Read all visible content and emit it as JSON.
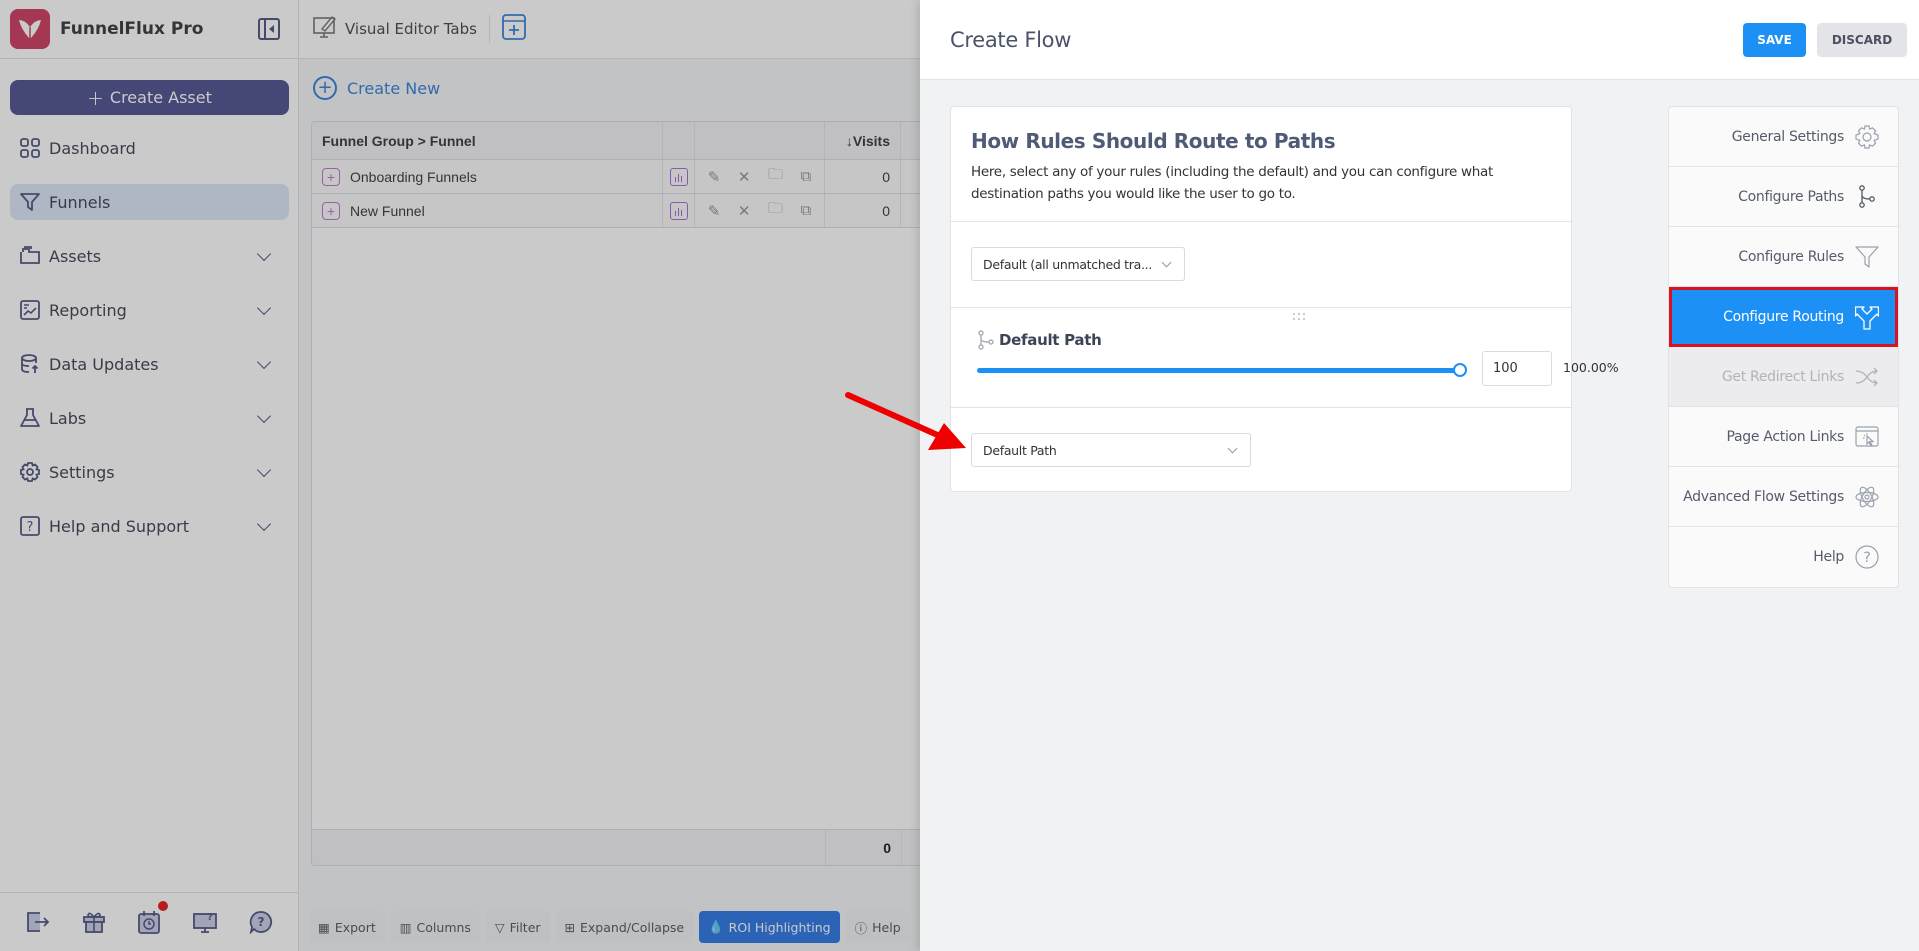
{
  "app": {
    "name": "FunnelFlux Pro",
    "brand_color": "#c8284e"
  },
  "sidebar": {
    "create_asset_label": "Create Asset",
    "items": [
      {
        "label": "Dashboard",
        "icon": "dashboard-icon",
        "active": false,
        "expandable": false
      },
      {
        "label": "Funnels",
        "icon": "funnel-icon",
        "active": true,
        "expandable": false
      },
      {
        "label": "Assets",
        "icon": "folder-icon",
        "active": false,
        "expandable": true
      },
      {
        "label": "Reporting",
        "icon": "report-chart-icon",
        "active": false,
        "expandable": true
      },
      {
        "label": "Data Updates",
        "icon": "database-upload-icon",
        "active": false,
        "expandable": true
      },
      {
        "label": "Labs",
        "icon": "flask-icon",
        "active": false,
        "expandable": true
      },
      {
        "label": "Settings",
        "icon": "gear-icon",
        "active": false,
        "expandable": true
      },
      {
        "label": "Help and Support",
        "icon": "question-box-icon",
        "active": false,
        "expandable": true
      }
    ],
    "footer_icons": [
      "logout-icon",
      "gift-icon",
      "calendar-clock-icon",
      "monitor-help-icon",
      "chat-help-icon"
    ],
    "notification_dot_color": "#e50000"
  },
  "topbar": {
    "tab_label": "Visual Editor Tabs"
  },
  "funnels_page": {
    "create_new_label": "Create New",
    "table": {
      "columns": [
        "Funnel Group > Funnel",
        "",
        "",
        "Visits"
      ],
      "sort_indicator": "↓",
      "rows": [
        {
          "name": "Onboarding Funnels",
          "visits": "0"
        },
        {
          "name": "New Funnel",
          "visits": "0"
        }
      ],
      "total_visits": "0"
    },
    "toolbar": {
      "export": "Export",
      "columns": "Columns",
      "filter": "Filter",
      "expand_collapse": "Expand/Collapse",
      "roi_highlighting": "ROI Highlighting",
      "help": "Help"
    }
  },
  "drawer": {
    "title": "Create Flow",
    "save_label": "SAVE",
    "discard_label": "DISCARD",
    "card": {
      "title": "How Rules Should Route to Paths",
      "description": "Here, select any of your rules (including the default) and you can configure what destination paths you would like the user to go to.",
      "rule_select_value": "Default (all unmatched tra...",
      "path": {
        "name": "Default Path",
        "weight_value": "100",
        "percent_label": "100.00%",
        "slider_fraction": 1.0
      },
      "path_select_value": "Default Path"
    },
    "menu": [
      {
        "label": "General Settings",
        "icon": "gear-icon",
        "state": "normal"
      },
      {
        "label": "Configure Paths",
        "icon": "branch-icon",
        "state": "normal"
      },
      {
        "label": "Configure Rules",
        "icon": "filter-icon",
        "state": "normal"
      },
      {
        "label": "Configure Routing",
        "icon": "split-arrows-icon",
        "state": "active"
      },
      {
        "label": "Get Redirect Links",
        "icon": "shuffle-icon",
        "state": "disabled"
      },
      {
        "label": "Page Action Links",
        "icon": "browser-click-icon",
        "state": "normal"
      },
      {
        "label": "Advanced Flow Settings",
        "icon": "atom-icon",
        "state": "normal"
      },
      {
        "label": "Help",
        "icon": "question-circle-icon",
        "state": "normal"
      }
    ],
    "accent_color": "#1d90f5",
    "highlight_border_color": "#d9121f"
  }
}
